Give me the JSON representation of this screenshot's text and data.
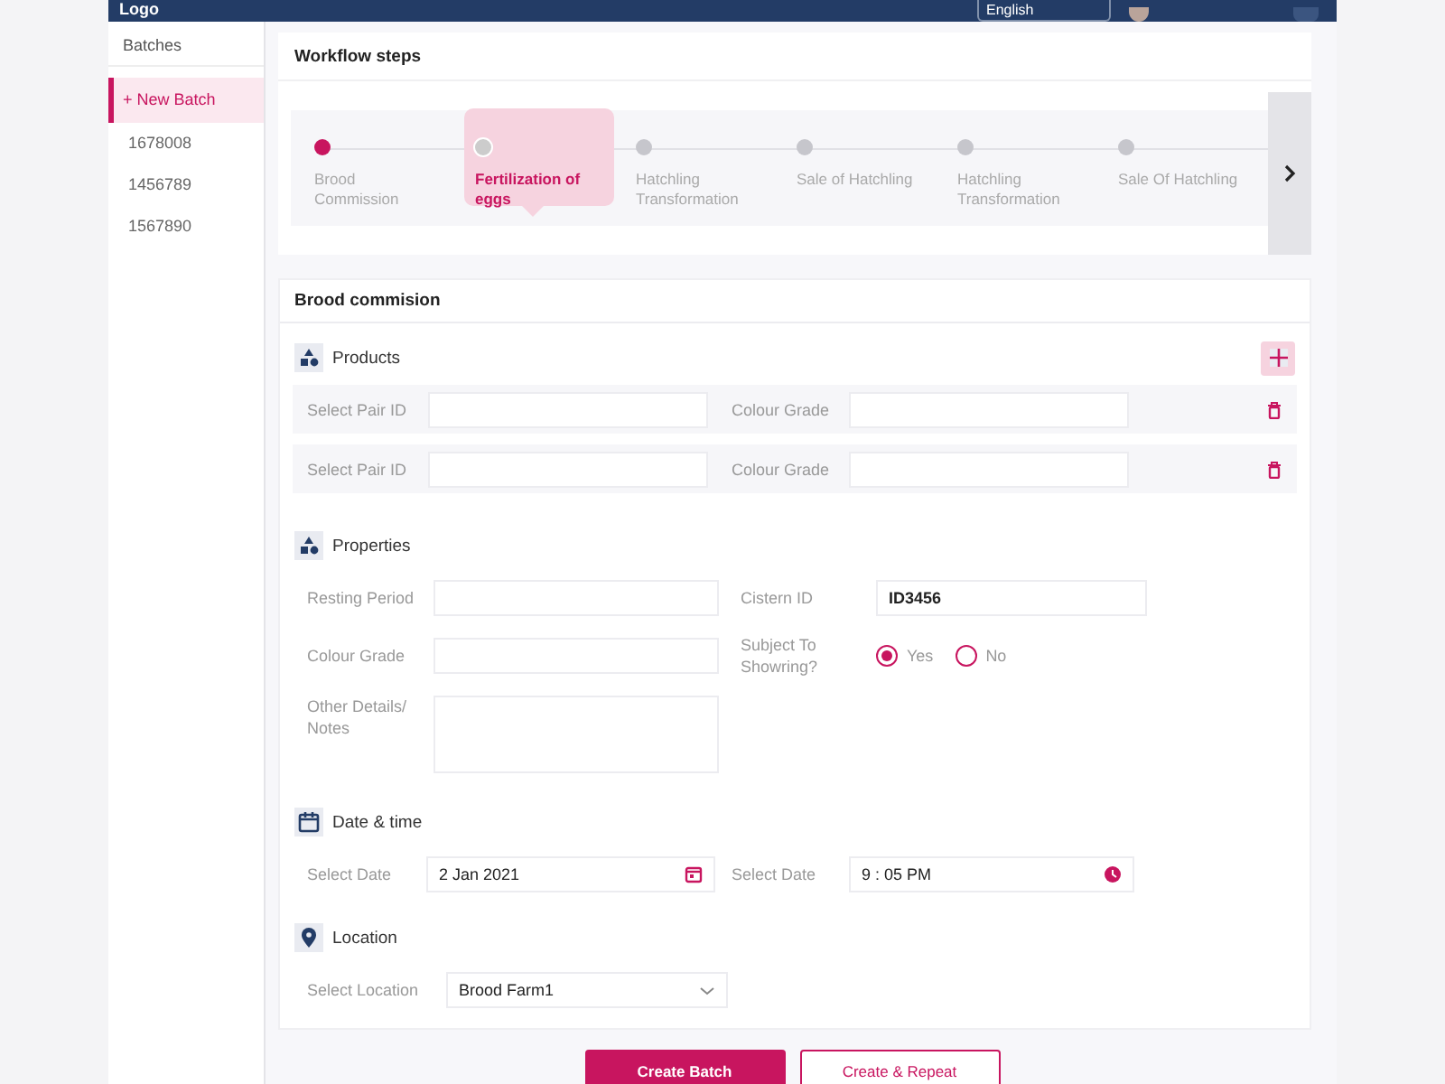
{
  "header": {
    "logo": "Logo",
    "language": "English"
  },
  "sidebar": {
    "title": "Batches",
    "items": [
      {
        "label": "+ New Batch",
        "selected": true
      },
      {
        "label": "1678008",
        "selected": false
      },
      {
        "label": "1456789",
        "selected": false
      },
      {
        "label": "1567890",
        "selected": false
      }
    ]
  },
  "workflow": {
    "title": "Workflow steps",
    "steps": [
      {
        "label": "Brood Commission",
        "completed": true,
        "selected": false
      },
      {
        "label": "Fertilization of eggs",
        "completed": false,
        "selected": true
      },
      {
        "label": "Hatchling Transformation",
        "completed": false,
        "selected": false
      },
      {
        "label": "Sale of Hatchling",
        "completed": false,
        "selected": false
      },
      {
        "label": "Hatchling Transformation",
        "completed": false,
        "selected": false
      },
      {
        "label": "Sale Of Hatchling",
        "completed": false,
        "selected": false
      }
    ]
  },
  "form": {
    "title": "Brood commision",
    "sections": [
      {
        "kind": "products",
        "title": "Products",
        "rows": [
          {
            "fields": [
              {
                "kind": "text",
                "label": "Select Pair ID"
              },
              {
                "kind": "text",
                "label": "Colour Grade"
              }
            ]
          },
          {
            "fields": [
              {
                "kind": "text",
                "label": "Select Pair ID"
              },
              {
                "kind": "text",
                "label": "Colour Grade"
              }
            ]
          }
        ]
      },
      {
        "kind": "properties",
        "title": "Properties",
        "fields": [
          {
            "kind": "text",
            "label": "Resting Period"
          },
          {
            "kind": "text",
            "label": "Colour Grade"
          },
          {
            "kind": "textarea",
            "label": "Other Details/ Notes"
          },
          {
            "kind": "text",
            "label": "Cistern ID",
            "value": "ID3456"
          },
          {
            "kind": "radio",
            "label": "Subject To Showring?",
            "options": [
              {
                "label": "Yes",
                "selected": true
              },
              {
                "label": "No",
                "selected": false
              }
            ]
          }
        ]
      },
      {
        "kind": "datetime",
        "title": "Date & time",
        "fields": [
          {
            "kind": "date",
            "label": "Select Date",
            "value": "2 Jan 2021"
          },
          {
            "kind": "time",
            "label": "Select Date",
            "value": "9 : 05 PM"
          }
        ]
      },
      {
        "kind": "location",
        "title": "Location",
        "fields": [
          {
            "kind": "select",
            "label": "Select Location",
            "value": "Brood Farm1"
          }
        ]
      }
    ]
  },
  "buttons": [
    {
      "label": "Create Batch",
      "kind": "primary"
    },
    {
      "label": "Create & Repeat",
      "kind": "secondary"
    }
  ]
}
